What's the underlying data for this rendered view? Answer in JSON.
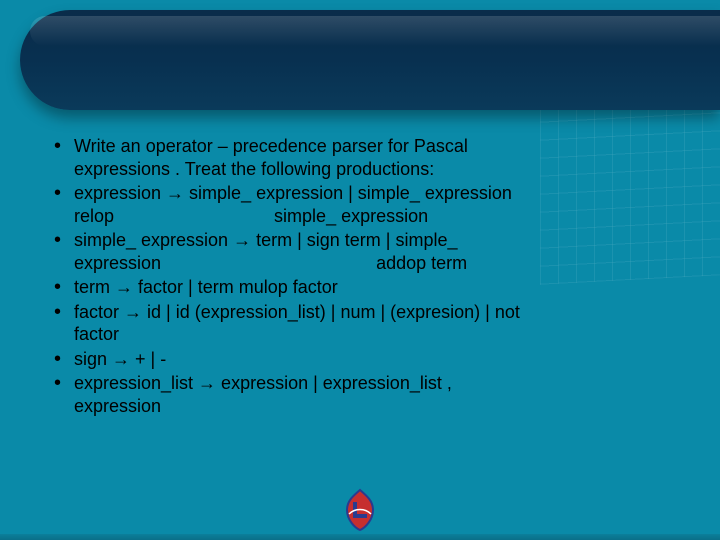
{
  "bullets": [
    {
      "line1": "Write an operator – precedence parser for Pascal",
      "line2": "expressions . Treat the following productions:"
    },
    {
      "line1": "expression → simple_ expression | simple_ expression",
      "line2": "relop                                simple_ expression"
    },
    {
      "line1": "simple_ expression → term | sign term | simple_",
      "line2": "expression                                           addop term"
    },
    {
      "line1": "term → factor | term mulop factor",
      "line2": ""
    },
    {
      "line1": "factor → id | id (expression_list) | num | (expresion) | not",
      "line2": "factor"
    },
    {
      "line1": "sign → + | -",
      "line2": ""
    },
    {
      "line1": "expression_list → expression | expression_list ,",
      "line2": "expression"
    }
  ],
  "logo": {
    "alt": "Louisiana Tech"
  }
}
